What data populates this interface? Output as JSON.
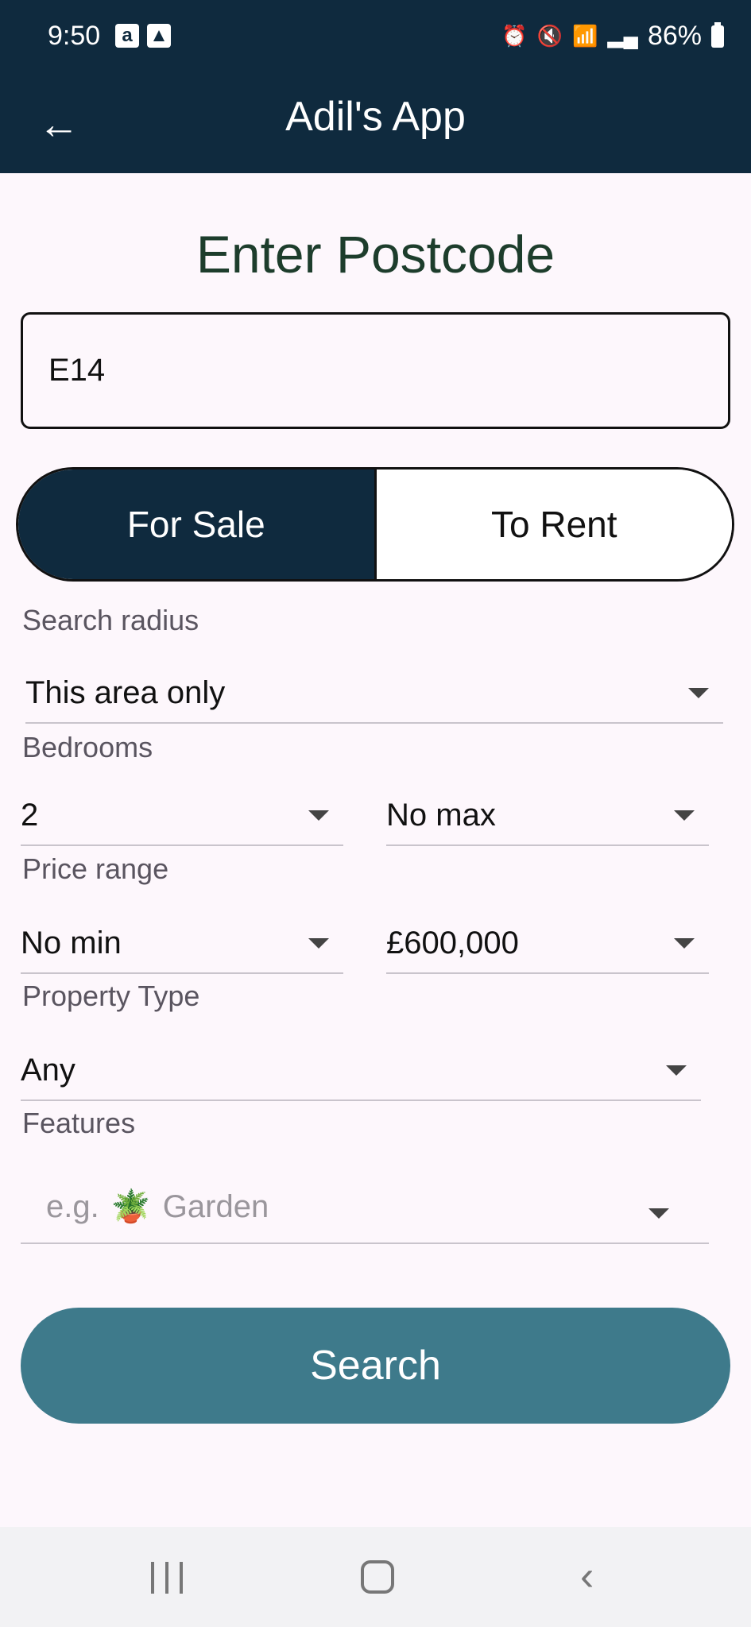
{
  "status_bar": {
    "time": "9:50",
    "left_icons": [
      "amazon-icon",
      "image-icon"
    ],
    "right_icons": [
      "alarm-icon",
      "mute-icon",
      "wifi-icon",
      "signal-icon"
    ],
    "battery": "86%"
  },
  "app_bar": {
    "title": "Adil's App",
    "back_icon": "arrow-left-icon"
  },
  "form": {
    "title": "Enter Postcode",
    "postcode_value": "E14",
    "tabs": [
      {
        "label": "For Sale",
        "active": true
      },
      {
        "label": "To Rent",
        "active": false
      }
    ],
    "search_radius": {
      "label": "Search radius",
      "value": "This area only"
    },
    "bedrooms": {
      "label": "Bedrooms",
      "min": "2",
      "max": "No max"
    },
    "price_range": {
      "label": "Price range",
      "min": "No min",
      "max": "£600,000"
    },
    "property_type": {
      "label": "Property Type",
      "value": "Any"
    },
    "features": {
      "label": "Features",
      "placeholder_prefix": "e.g.",
      "placeholder_text": "Garden",
      "placeholder_emoji": "🪴"
    },
    "search_button": "Search"
  },
  "colors": {
    "header": "#0f2a3e",
    "background": "#fdf7fc",
    "search_button": "#3e7a8b",
    "title": "#1d3d2c"
  }
}
